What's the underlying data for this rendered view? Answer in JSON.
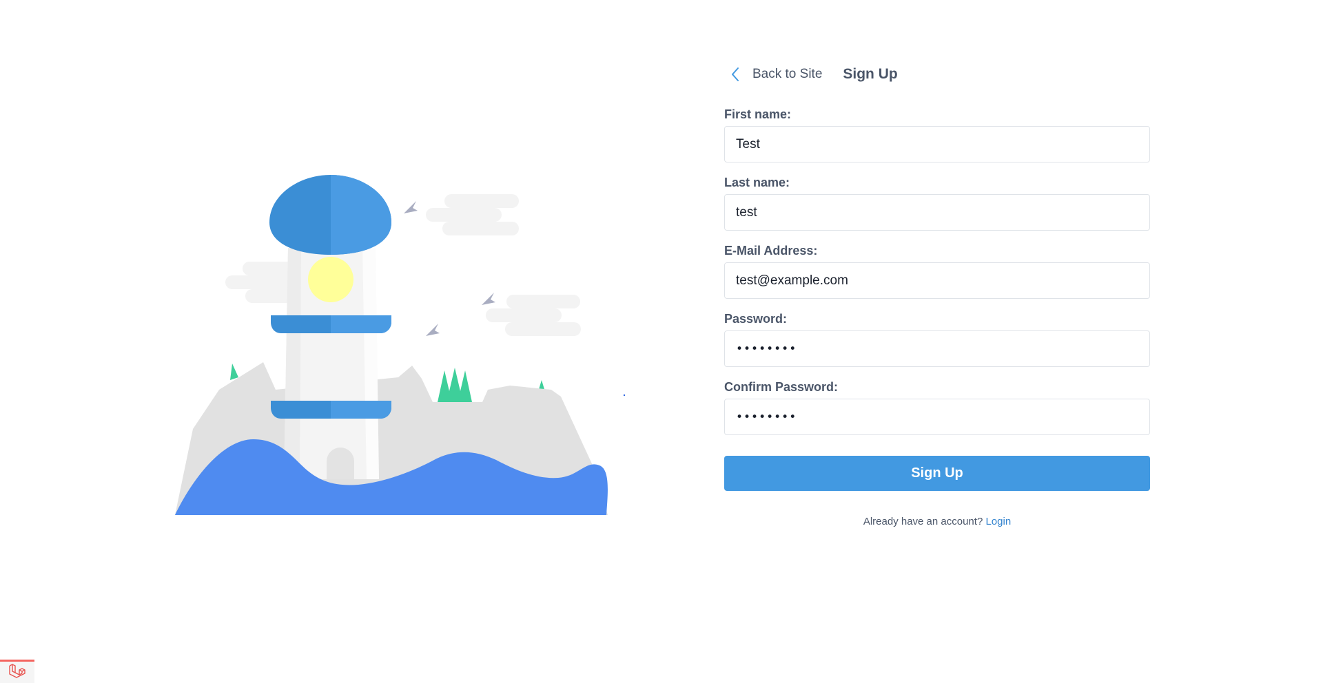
{
  "header": {
    "back_label": "Back to Site",
    "back_icon": "chevron-left-icon",
    "title": "Sign Up"
  },
  "form": {
    "first_name": {
      "label": "First name:",
      "value": "Test"
    },
    "last_name": {
      "label": "Last name:",
      "value": "test"
    },
    "email": {
      "label": "E-Mail Address:",
      "value": "test@example.com"
    },
    "password": {
      "label": "Password:",
      "value": "password"
    },
    "confirm_password": {
      "label": "Confirm Password:",
      "value": "password"
    },
    "submit_label": "Sign Up"
  },
  "footer": {
    "prompt": "Already have an account?",
    "login_label": "Login"
  },
  "debugbar": {
    "icon": "laravel-logo-icon"
  },
  "colors": {
    "accent": "#4299e1",
    "link": "#3182ce",
    "text": "#4a5568",
    "illustration_blue": "#4f8bf0",
    "illustration_green": "#3ecf9a"
  }
}
